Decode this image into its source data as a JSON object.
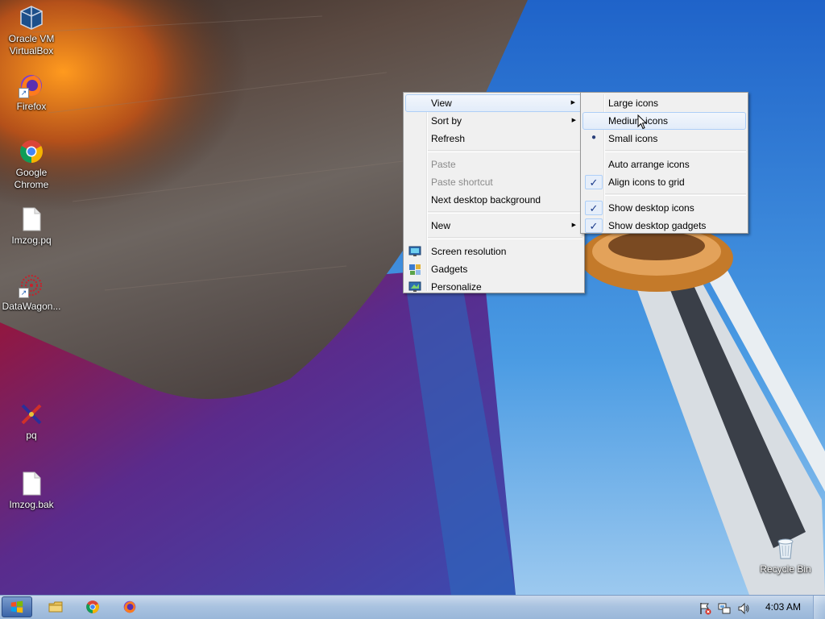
{
  "desktop": {
    "icons": [
      {
        "label": "Oracle VM VirtualBox",
        "icon": "virtualbox-icon"
      },
      {
        "label": "Firefox",
        "icon": "firefox-icon"
      },
      {
        "label": "Google Chrome",
        "icon": "chrome-icon"
      },
      {
        "label": "Imzog.pq",
        "icon": "file-icon"
      },
      {
        "label": "DataWagon...",
        "icon": "datawagon-icon"
      },
      {
        "label": "pq",
        "icon": "pq-icon"
      },
      {
        "label": "Imzog.bak",
        "icon": "file-icon"
      },
      {
        "label": "Recycle Bin",
        "icon": "recycle-bin-icon"
      }
    ]
  },
  "context_menu": {
    "items": [
      {
        "label": "View",
        "submenu": true,
        "highlighted": true
      },
      {
        "label": "Sort by",
        "submenu": true
      },
      {
        "label": "Refresh"
      },
      {
        "label": "Paste",
        "disabled": true
      },
      {
        "label": "Paste shortcut",
        "disabled": true
      },
      {
        "label": "Next desktop background"
      },
      {
        "label": "New",
        "submenu": true
      },
      {
        "label": "Screen resolution",
        "icon": "display-icon"
      },
      {
        "label": "Gadgets",
        "icon": "gadgets-icon"
      },
      {
        "label": "Personalize",
        "icon": "personalize-icon"
      }
    ]
  },
  "view_submenu": {
    "items": [
      {
        "label": "Large icons"
      },
      {
        "label": "Medium icons",
        "highlighted": true
      },
      {
        "label": "Small icons",
        "selected": true
      },
      {
        "label": "Auto arrange icons"
      },
      {
        "label": "Align icons to grid",
        "checked": true
      },
      {
        "label": "Show desktop icons",
        "checked": true
      },
      {
        "label": "Show desktop gadgets",
        "checked": true
      }
    ]
  },
  "taskbar": {
    "pinned": [
      "explorer-icon",
      "chrome-icon",
      "firefox-icon"
    ],
    "tray": [
      "action-center-flag-icon",
      "network-icon",
      "volume-icon"
    ],
    "clock": "4:03 AM"
  },
  "colors": {
    "menu_highlight_border": "#aecff7",
    "taskbar": "#aac3e0",
    "sky": "#3f8ed6"
  }
}
